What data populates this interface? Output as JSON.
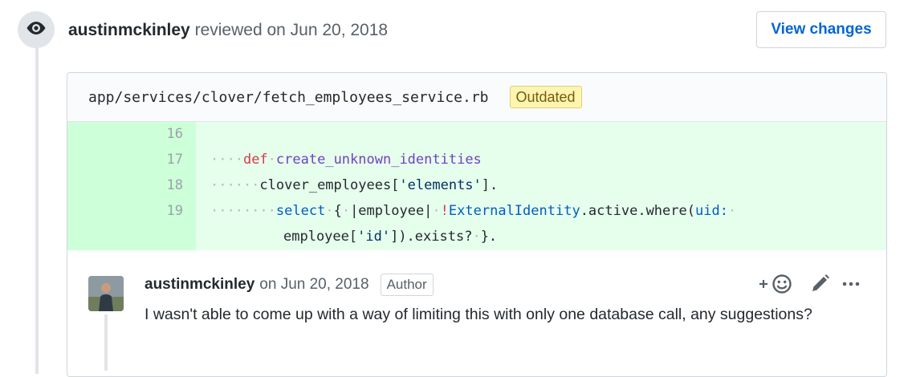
{
  "review": {
    "author": "austinmckinley",
    "action_text": "reviewed on Jun 20, 2018",
    "view_changes_label": "View changes",
    "icon": "eye-icon"
  },
  "file": {
    "path": "app/services/clover/fetch_employees_service.rb",
    "badge": "Outdated",
    "lines": [
      {
        "number": "16",
        "code": ""
      },
      {
        "number": "17",
        "code": "····def·create_unknown_identities"
      },
      {
        "number": "18",
        "code": "······clover_employees['elements']."
      },
      {
        "number": "19",
        "code": "········select·{·|employee|·!ExternalIdentity.active.where(uid:·"
      },
      {
        "number": "",
        "code": "employee['id']).exists?·}."
      }
    ]
  },
  "comment": {
    "author": "austinmckinley",
    "date": "on Jun 20, 2018",
    "badge": "Author",
    "body": "I wasn't able to come up with a way of limiting this with only one database call, any suggestions?",
    "actions": {
      "reaction_icon": "add-reaction-icon",
      "edit_icon": "pencil-icon",
      "more_icon": "more-options-icon"
    }
  },
  "colors": {
    "link": "#0366d6",
    "diff_added_bg": "#e6ffed",
    "diff_added_gutter": "#cdffd8",
    "outdated_bg": "#fff5b1",
    "keyword": "#d73a49",
    "function": "#6f42c1",
    "string": "#032f62",
    "constant": "#005cc5"
  }
}
